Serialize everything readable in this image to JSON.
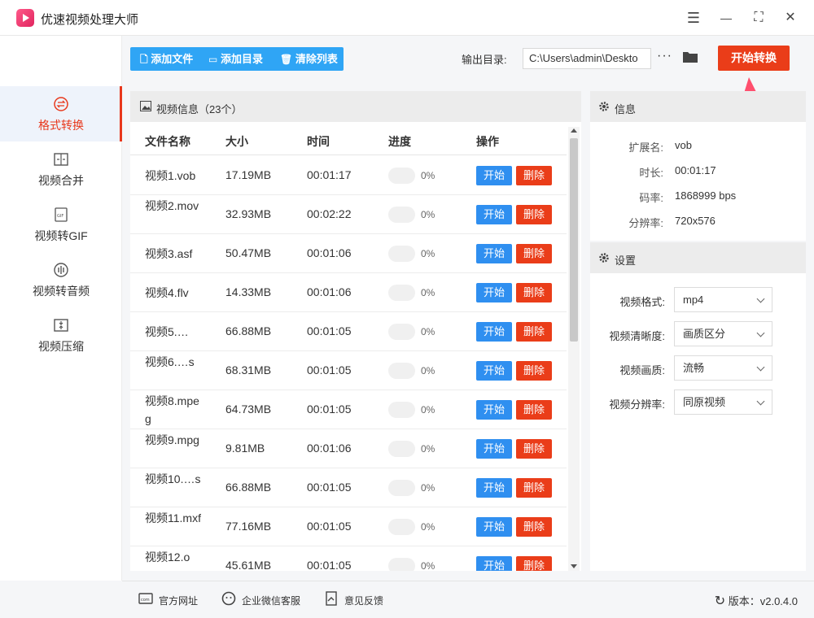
{
  "app": {
    "title": "优速视频处理大师"
  },
  "window_controls": {
    "menu": "☰",
    "minimize": "—",
    "maximize": "⛶",
    "close": "✕"
  },
  "sidebar": {
    "items": [
      {
        "label": "格式转换",
        "icon": "format-convert-icon",
        "active": true
      },
      {
        "label": "视频合并",
        "icon": "merge-icon",
        "active": false
      },
      {
        "label": "视频转GIF",
        "icon": "gif-icon",
        "active": false
      },
      {
        "label": "视频转音频",
        "icon": "audio-icon",
        "active": false
      },
      {
        "label": "视频压缩",
        "icon": "compress-icon",
        "active": false
      }
    ]
  },
  "toolbar": {
    "add_file": "添加文件",
    "add_folder": "添加目录",
    "clear_list": "清除列表",
    "output_label": "输出目录:",
    "output_path": "C:\\Users\\admin\\Deskto",
    "more": "···",
    "start_all": "开始转换"
  },
  "file_list": {
    "title": "视频信息（23个）",
    "columns": [
      "文件名称",
      "大小",
      "时间",
      "进度",
      "操作"
    ],
    "start_label": "开始",
    "delete_label": "删除",
    "rows": [
      {
        "name": "视频1.vob",
        "size": "17.19MB",
        "time": "00:01:17",
        "progress": "0%"
      },
      {
        "name": "视频2.mov",
        "size": "32.93MB",
        "time": "00:02:22",
        "progress": "0%"
      },
      {
        "name": "视频3.asf",
        "size": "50.47MB",
        "time": "00:01:06",
        "progress": "0%"
      },
      {
        "name": "视频4.flv",
        "size": "14.33MB",
        "time": "00:01:06",
        "progress": "0%"
      },
      {
        "name": "视频5.…",
        "size": "66.88MB",
        "time": "00:01:05",
        "progress": "0%"
      },
      {
        "name": "视频6.…s",
        "size": "68.31MB",
        "time": "00:01:05",
        "progress": "0%"
      },
      {
        "name": "视频8.mpeg",
        "size": "64.73MB",
        "time": "00:01:05",
        "progress": "0%"
      },
      {
        "name": "视频9.mpg",
        "size": "9.81MB",
        "time": "00:01:06",
        "progress": "0%"
      },
      {
        "name": "视频10.…s",
        "size": "66.88MB",
        "time": "00:01:05",
        "progress": "0%"
      },
      {
        "name": "视频11.mxf",
        "size": "77.16MB",
        "time": "00:01:05",
        "progress": "0%"
      },
      {
        "name": "视频12.o",
        "size": "45.61MB",
        "time": "00:01:05",
        "progress": "0%"
      }
    ]
  },
  "info": {
    "title": "信息",
    "fields": [
      {
        "label": "扩展名:",
        "value": "vob"
      },
      {
        "label": "时长:",
        "value": "00:01:17"
      },
      {
        "label": "码率:",
        "value": "1868999 bps"
      },
      {
        "label": "分辨率:",
        "value": "720x576"
      }
    ]
  },
  "settings": {
    "title": "设置",
    "fields": [
      {
        "label": "视频格式:",
        "value": "mp4"
      },
      {
        "label": "视频清晰度:",
        "value": "画质区分"
      },
      {
        "label": "视频画质:",
        "value": "流畅"
      },
      {
        "label": "视频分辨率:",
        "value": "同原视频"
      }
    ]
  },
  "footer": {
    "website": "官方网址",
    "wechat": "企业微信客服",
    "feedback": "意见反馈",
    "version": "版本：v2.0.4.0"
  },
  "colors": {
    "accent_red": "#ea3d19",
    "accent_blue": "#2fa5f5",
    "button_blue": "#2f8ff0"
  }
}
